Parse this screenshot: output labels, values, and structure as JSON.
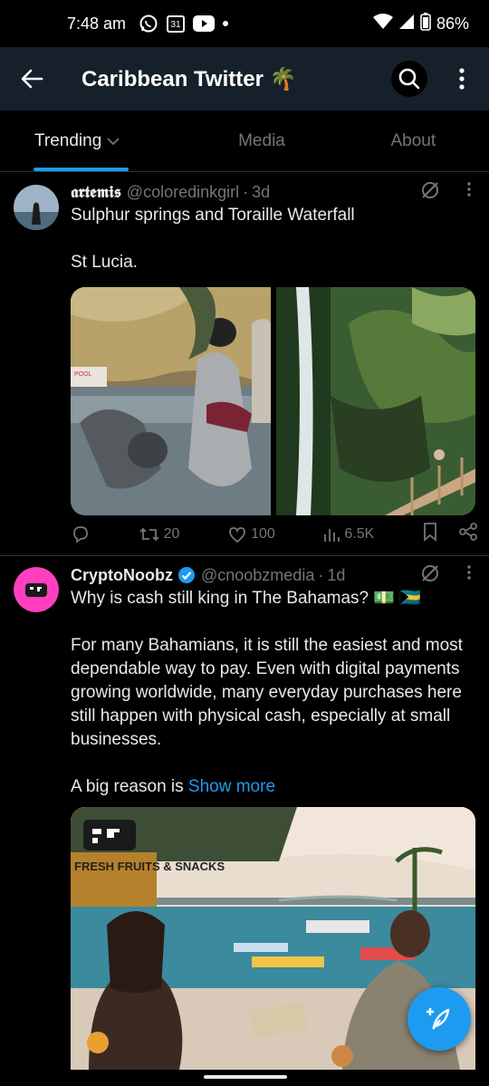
{
  "status_bar": {
    "time": "7:48 am",
    "battery": "86%",
    "calendar_day": "31"
  },
  "header": {
    "title": "Caribbean Twitter 🌴"
  },
  "tabs": [
    {
      "label": "Trending"
    },
    {
      "label": "Media"
    },
    {
      "label": "About"
    }
  ],
  "tweets": [
    {
      "name": "𝖆𝖗𝖙𝖊𝖒𝖎𝖘",
      "handle": "@coloredinkgirl",
      "dot": "·",
      "time": "3d",
      "text": "Sulphur springs and Toraille Waterfall\n\nSt Lucia.",
      "pool_sign": "POOL",
      "actions": {
        "retweets": "20",
        "likes": "100",
        "views": "6.5K"
      }
    },
    {
      "name": "CryptoNoobz",
      "handle": "@cnoobzmedia",
      "dot": "·",
      "time": "1d",
      "text": "Why is cash still king in The Bahamas? 💵 🇧🇸\n\nFor many Bahamians, it is still the easiest and most dependable way to pay. Even with digital payments growing worldwide, many everyday purchases here still happen with physical cash, especially at small businesses.\n\nA big reason is ",
      "show_more": "Show more",
      "image_sign": "FRESH FRUITS & SNACKS"
    }
  ],
  "colors": {
    "accent": "#1d9bf0",
    "header_bg": "#15202b",
    "muted": "#71767b"
  }
}
